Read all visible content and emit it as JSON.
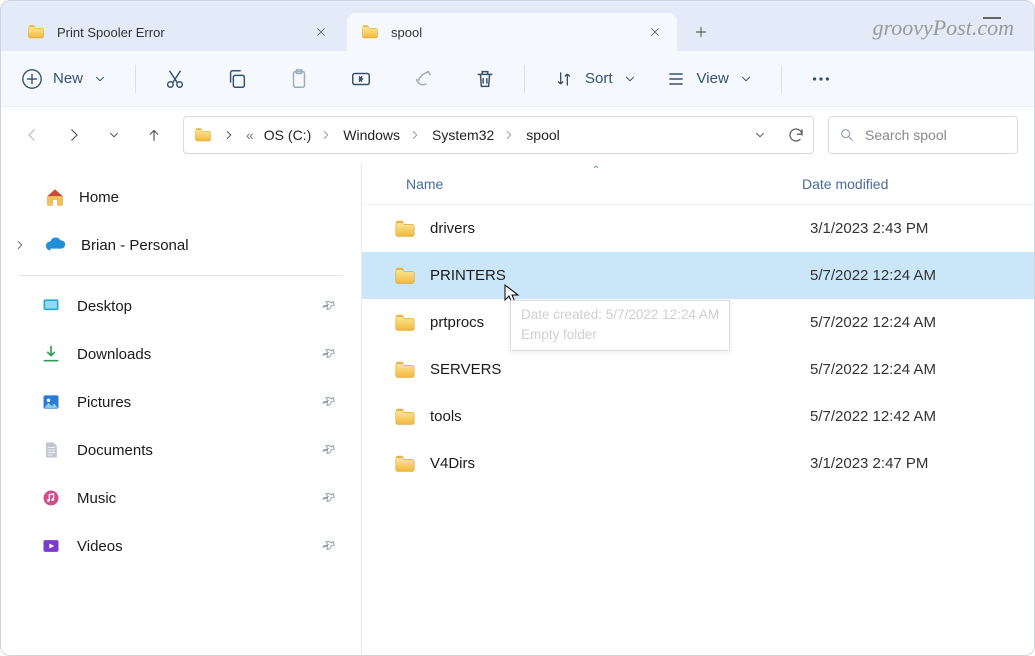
{
  "tabs": [
    {
      "title": "Print Spooler Error",
      "active": false
    },
    {
      "title": "spool",
      "active": true
    }
  ],
  "watermark": "groovyPost.com",
  "toolbar": {
    "new_label": "New",
    "sort_label": "Sort",
    "view_label": "View"
  },
  "breadcrumb": {
    "root": "OS (C:)",
    "seg1": "Windows",
    "seg2": "System32",
    "seg3": "spool"
  },
  "search": {
    "placeholder": "Search spool"
  },
  "sidebar": {
    "home": "Home",
    "cloud": "Brian - Personal",
    "quick": [
      {
        "label": "Desktop"
      },
      {
        "label": "Downloads"
      },
      {
        "label": "Pictures"
      },
      {
        "label": "Documents"
      },
      {
        "label": "Music"
      },
      {
        "label": "Videos"
      }
    ]
  },
  "columns": {
    "name": "Name",
    "date": "Date modified"
  },
  "rows": [
    {
      "name": "drivers",
      "date": "3/1/2023 2:43 PM",
      "selected": false
    },
    {
      "name": "PRINTERS",
      "date": "5/7/2022 12:24 AM",
      "selected": true
    },
    {
      "name": "prtprocs",
      "date": "5/7/2022 12:24 AM",
      "selected": false
    },
    {
      "name": "SERVERS",
      "date": "5/7/2022 12:24 AM",
      "selected": false
    },
    {
      "name": "tools",
      "date": "5/7/2022 12:42 AM",
      "selected": false
    },
    {
      "name": "V4Dirs",
      "date": "3/1/2023 2:47 PM",
      "selected": false
    }
  ],
  "tooltip": {
    "line1": "Date created: 5/7/2022 12:24 AM",
    "line2": "Empty folder"
  }
}
